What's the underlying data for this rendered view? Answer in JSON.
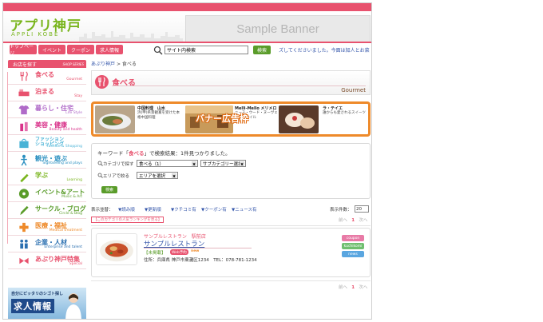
{
  "header": {
    "logo": "アプリ神戸",
    "logo_sub": "APPLI KOBE",
    "banner": "Sample Banner"
  },
  "nav": {
    "items": [
      "トップページ",
      "イベント",
      "クーポン",
      "求人情報"
    ],
    "search_value": "サイト内検索",
    "search_button": "検索",
    "ticker": "ズしてくださいました。今面は知人とお菜"
  },
  "sidebar": {
    "header": "お店を探す",
    "header_sub": "SHOP SERIES",
    "items": [
      {
        "label": "食べる",
        "en": "Gourmet",
        "icon": "fork-knife-icon",
        "color": "#e8526e"
      },
      {
        "label": "泊まる",
        "en": "Stay",
        "icon": "bed-icon",
        "color": "#e8526e"
      },
      {
        "label": "暮らし・住宅",
        "en": "Life Style",
        "icon": "shirt-icon",
        "color": "#b06ac8"
      },
      {
        "label": "美容・健康",
        "en": "Beauty and health",
        "icon": "cosmetics-icon",
        "color": "#d9328a"
      },
      {
        "label": "ファッション\nショッピング",
        "en": "Fashion & Shopping",
        "icon": "bag-icon",
        "color": "#4ab3d6"
      },
      {
        "label": "観光・遊ぶ",
        "en": "Sightseeing and plays",
        "icon": "person-icon",
        "color": "#2a8fc0"
      },
      {
        "label": "学ぶ",
        "en": "Learning",
        "icon": "pencil-icon",
        "color": "#79b51d"
      },
      {
        "label": "イベント&アート",
        "en": "Music & Art",
        "icon": "cd-icon",
        "color": "#5a9c2a"
      },
      {
        "label": "サークル・ブログ",
        "en": "Circle & Blog",
        "icon": "pen-icon",
        "color": "#5a9c2a"
      },
      {
        "label": "医療・福祉",
        "en": "Medical treatment",
        "icon": "medical-icon",
        "color": "#ee8a2a"
      },
      {
        "label": "企業・人材",
        "en": "Enterprise and talent",
        "icon": "people-icon",
        "color": "#2a6fb0"
      },
      {
        "label": "あぷり神戸特集",
        "en": "Special",
        "icon": "ribbon-icon",
        "color": "#e8526e"
      }
    ],
    "jobs_line": "自分にピッタリのシゴト探し",
    "jobs_title": "求人情報"
  },
  "main": {
    "breadcrumb": [
      "あぷり神戸",
      "食べる"
    ],
    "breadcrumb_sep": ">",
    "title": "食べる",
    "title_en": "Gourmet",
    "promo": {
      "overlay": "バナー広告枠",
      "items": [
        {
          "name": "中国料理　山水",
          "desc": "浜(甲)県景観賞を受けた本格中国料理"
        },
        {
          "name": "Melli-Mello メリメロ",
          "desc": "ニース・ウード・ヌーヴェル・スタイル"
        },
        {
          "name": "ラ・テイエ",
          "desc": "誰からも愛されるスイーツ"
        }
      ]
    },
    "filter": {
      "result_prefix": "キーワード「",
      "keyword": "食べる",
      "result_mid": "」で検索結果：",
      "count": "1",
      "result_suffix": "件見つかりました。",
      "category_label": "カテゴリで探す",
      "category_value": "食べる（1）",
      "subcategory_value": "サブカテゴリー選択",
      "area_label": "エリアで絞る",
      "area_value": "エリアを選択",
      "search_button": "検索"
    },
    "sort": {
      "label": "表示並替：",
      "options": [
        "▼読み順",
        "▼更新順",
        "▼クチコミ有",
        "▼クーポン有",
        "▼ニュース有"
      ],
      "perpage_label": "表示件数：",
      "perpage_value": "20"
    },
    "ranking": "【このカテゴリの人気ランキングを見る】",
    "pager": {
      "prev": "前へ",
      "current": "1",
      "next": "次へ"
    },
    "listing": {
      "catch": "サンプルレストラン　駅前店",
      "name": "サンプルレストラン",
      "genre": "【未掲載】",
      "web_badge": "Web予約",
      "new_badge": "new",
      "address": "住所：兵庫県 神戸市東灘区1234　TEL：078-781-1234",
      "badges": [
        {
          "label": "coupon",
          "color": "#e87aa6"
        },
        {
          "label": "kuchikomi",
          "color": "#6fbf6f"
        },
        {
          "label": "news",
          "color": "#5aa6e0"
        }
      ]
    }
  }
}
